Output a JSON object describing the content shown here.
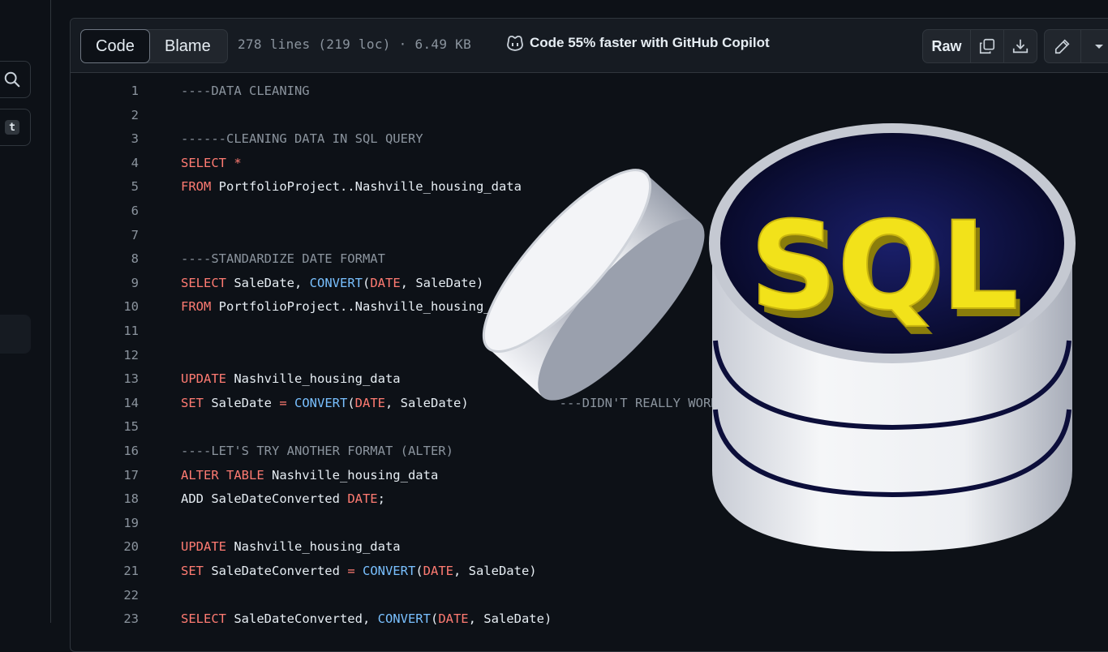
{
  "file_header": {
    "tabs": [
      {
        "label": "Code",
        "active": true
      },
      {
        "label": "Blame",
        "active": false
      }
    ],
    "meta": "278 lines (219 loc) · 6.49 KB",
    "copilot_text": "Code 55% faster with GitHub Copilot",
    "raw_label": "Raw",
    "icons": [
      "copy-icon",
      "download-icon",
      "pencil-icon",
      "chevron-down-icon"
    ]
  },
  "left_rail": {
    "icons": [
      "search-icon",
      "symbol-icon"
    ],
    "symbol_letter": "t"
  },
  "code_lines": [
    {
      "n": "1",
      "tokens": [
        {
          "t": "----DATA CLEANING",
          "c": "cm"
        }
      ]
    },
    {
      "n": "2",
      "tokens": []
    },
    {
      "n": "3",
      "tokens": [
        {
          "t": "------CLEANING DATA IN SQL QUERY",
          "c": "cm"
        }
      ]
    },
    {
      "n": "4",
      "tokens": [
        {
          "t": "SELECT *",
          "c": "kw"
        }
      ]
    },
    {
      "n": "5",
      "tokens": [
        {
          "t": "FROM ",
          "c": "kw"
        },
        {
          "t": "PortfolioProject..Nashville_housing_data",
          "c": "tx"
        }
      ]
    },
    {
      "n": "6",
      "tokens": []
    },
    {
      "n": "7",
      "tokens": []
    },
    {
      "n": "8",
      "tokens": [
        {
          "t": "----STANDARDIZE DATE FORMAT",
          "c": "cm"
        }
      ]
    },
    {
      "n": "9",
      "tokens": [
        {
          "t": "SELECT ",
          "c": "kw"
        },
        {
          "t": "SaleDate, ",
          "c": "tx"
        },
        {
          "t": "CONVERT",
          "c": "fn"
        },
        {
          "t": "(",
          "c": "tx"
        },
        {
          "t": "DATE",
          "c": "kw"
        },
        {
          "t": ", SaleDate)",
          "c": "tx"
        }
      ]
    },
    {
      "n": "10",
      "tokens": [
        {
          "t": "FROM ",
          "c": "kw"
        },
        {
          "t": "PortfolioProject..Nashville_housing_data",
          "c": "tx"
        }
      ]
    },
    {
      "n": "11",
      "tokens": []
    },
    {
      "n": "12",
      "tokens": []
    },
    {
      "n": "13",
      "tokens": [
        {
          "t": "UPDATE ",
          "c": "kw"
        },
        {
          "t": "Nashville_housing_data",
          "c": "tx"
        }
      ]
    },
    {
      "n": "14",
      "tokens": [
        {
          "t": "SET ",
          "c": "kw"
        },
        {
          "t": "SaleDate ",
          "c": "tx"
        },
        {
          "t": "= ",
          "c": "kw"
        },
        {
          "t": "CONVERT",
          "c": "fn"
        },
        {
          "t": "(",
          "c": "tx"
        },
        {
          "t": "DATE",
          "c": "kw"
        },
        {
          "t": ", SaleDate)            ",
          "c": "tx"
        },
        {
          "t": "---DIDN'T REALLY WORK FOR ME",
          "c": "cm"
        }
      ]
    },
    {
      "n": "15",
      "tokens": []
    },
    {
      "n": "16",
      "tokens": [
        {
          "t": "----LET'S TRY ANOTHER FORMAT (ALTER)",
          "c": "cm"
        }
      ]
    },
    {
      "n": "17",
      "tokens": [
        {
          "t": "ALTER TABLE ",
          "c": "kw"
        },
        {
          "t": "Nashville_housing_data",
          "c": "tx"
        }
      ]
    },
    {
      "n": "18",
      "tokens": [
        {
          "t": "ADD SaleDateConverted ",
          "c": "tx"
        },
        {
          "t": "DATE",
          "c": "kw"
        },
        {
          "t": ";",
          "c": "tx"
        }
      ]
    },
    {
      "n": "19",
      "tokens": []
    },
    {
      "n": "20",
      "tokens": [
        {
          "t": "UPDATE ",
          "c": "kw"
        },
        {
          "t": "Nashville_housing_data",
          "c": "tx"
        }
      ]
    },
    {
      "n": "21",
      "tokens": [
        {
          "t": "SET ",
          "c": "kw"
        },
        {
          "t": "SaleDateConverted ",
          "c": "tx"
        },
        {
          "t": "= ",
          "c": "kw"
        },
        {
          "t": "CONVERT",
          "c": "fn"
        },
        {
          "t": "(",
          "c": "tx"
        },
        {
          "t": "DATE",
          "c": "kw"
        },
        {
          "t": ", SaleDate)",
          "c": "tx"
        }
      ]
    },
    {
      "n": "22",
      "tokens": []
    },
    {
      "n": "23",
      "tokens": [
        {
          "t": "SELECT ",
          "c": "kw"
        },
        {
          "t": "SaleDateConverted, ",
          "c": "tx"
        },
        {
          "t": "CONVERT",
          "c": "fn"
        },
        {
          "t": "(",
          "c": "tx"
        },
        {
          "t": "DATE",
          "c": "kw"
        },
        {
          "t": ", SaleDate)",
          "c": "tx"
        }
      ]
    }
  ],
  "overlay": {
    "logo_text": "SQL",
    "colors": {
      "cylinder": "#e8eaef",
      "letters": "#f2e21a",
      "navy": "#0c0e3a"
    }
  }
}
